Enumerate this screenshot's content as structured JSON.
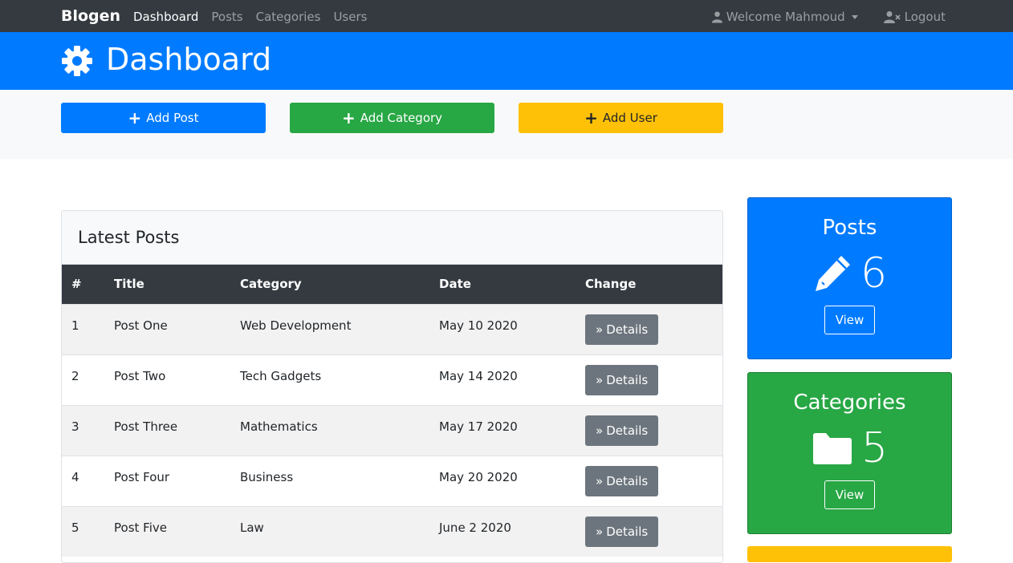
{
  "nav": {
    "brand": "Blogen",
    "links": [
      "Dashboard",
      "Posts",
      "Categories",
      "Users"
    ],
    "welcome": "Welcome Mahmoud",
    "logout": "Logout"
  },
  "header": {
    "title": "Dashboard",
    "icon": "gear-icon"
  },
  "actions": {
    "add_post": "Add Post",
    "add_category": "Add Category",
    "add_user": "Add User"
  },
  "latest": {
    "title": "Latest Posts",
    "columns": [
      "#",
      "Title",
      "Category",
      "Date",
      "Change"
    ],
    "rows": [
      {
        "num": "1",
        "title": "Post One",
        "category": "Web Development",
        "date": "May 10 2020",
        "action": "Details"
      },
      {
        "num": "2",
        "title": "Post Two",
        "category": "Tech Gadgets",
        "date": "May 14 2020",
        "action": "Details"
      },
      {
        "num": "3",
        "title": "Post Three",
        "category": "Mathematics",
        "date": "May 17 2020",
        "action": "Details"
      },
      {
        "num": "4",
        "title": "Post Four",
        "category": "Business",
        "date": "May 20 2020",
        "action": "Details"
      },
      {
        "num": "5",
        "title": "Post Five",
        "category": "Law",
        "date": "June 2 2020",
        "action": "Details"
      }
    ]
  },
  "stats": {
    "posts": {
      "label": "Posts",
      "count": "6",
      "button": "View",
      "icon": "pencil-icon"
    },
    "categories": {
      "label": "Categories",
      "count": "5",
      "button": "View",
      "icon": "folder-icon"
    }
  },
  "colors": {
    "primary": "#007bff",
    "success": "#28a745",
    "warning": "#ffc107",
    "dark": "#343a40",
    "secondary": "#6c757d"
  }
}
